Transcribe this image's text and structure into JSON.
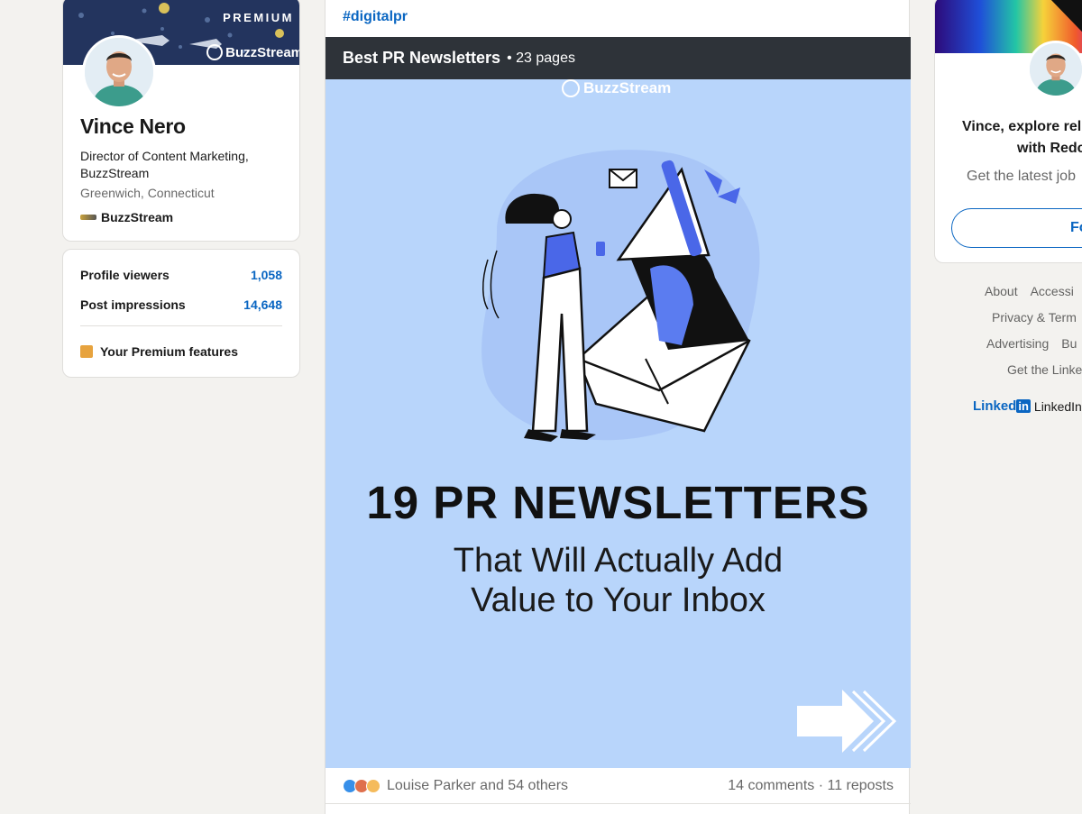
{
  "profile": {
    "premium_label": "PREMIUM",
    "banner_brand": "BuzzStream",
    "name": "Vince Nero",
    "headline": "Director of Content Marketing, BuzzStream",
    "location": "Greenwich, Connecticut",
    "company": "BuzzStream"
  },
  "stats": {
    "profile_viewers_label": "Profile viewers",
    "profile_viewers_value": "1,058",
    "post_impressions_label": "Post impressions",
    "post_impressions_value": "14,648",
    "premium_features_label": "Your Premium features"
  },
  "post": {
    "hashtag": "#digitalpr",
    "document_title": "Best PR Newsletters",
    "document_pages": "• 23 pages",
    "slide": {
      "brand": "BuzzStream",
      "headline": "19 PR NEWSLETTERS",
      "subheadline_line1": "That Will Actually Add",
      "subheadline_line2": "Value to Your Inbox"
    },
    "reactions_text": "Louise Parker and 54 others",
    "engagement_text": "14 comments · 11 reposts"
  },
  "ad": {
    "line1": "Vince, explore rel",
    "line2": "with Redc",
    "sub": "Get the latest job",
    "follow_label": "Fo"
  },
  "footer": {
    "row1": [
      "About",
      "Accessi"
    ],
    "row2": [
      "Privacy & Term"
    ],
    "row3": [
      "Advertising",
      "Bu"
    ],
    "row4": [
      "Get the Linke"
    ],
    "brand_word": "Linked",
    "brand_in": "in",
    "brand_tail": "LinkedIn"
  },
  "colors": {
    "linkedin_blue": "#0a66c2",
    "doc_header": "#2e3339",
    "slide_background": "#b8d5fb",
    "page_background": "#f3f2ef"
  },
  "icons": [
    "buzzstream-logo-icon",
    "premium-icon",
    "like-reaction-icon",
    "love-reaction-icon",
    "insightful-reaction-icon",
    "next-slide-arrow-icon",
    "linkedin-logo-icon"
  ]
}
